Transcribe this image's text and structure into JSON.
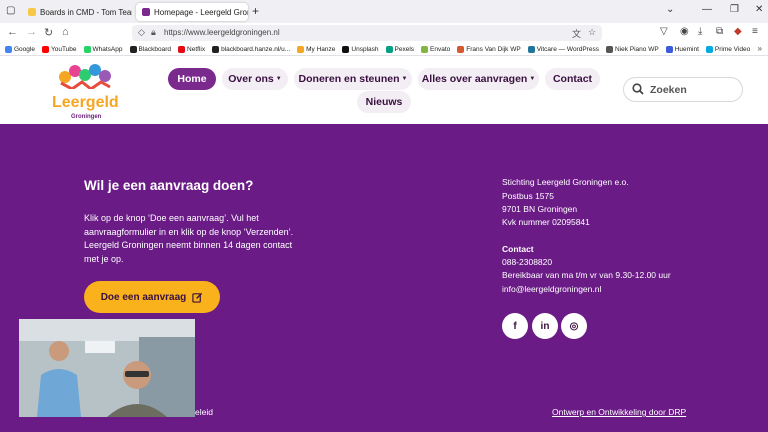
{
  "browser": {
    "tabs": [
      {
        "label": "Boards in CMD - Tom Team - …",
        "active": false,
        "favicon_color": "#f7c948"
      },
      {
        "label": "Homepage - Leergeld Groningen",
        "active": true,
        "favicon_color": "#7a2a8c"
      }
    ],
    "new_tab_label": "+",
    "url": "https://www.leergeldgroningen.nl",
    "bookmarks": [
      {
        "label": "Google",
        "color": "#4285f4"
      },
      {
        "label": "YouTube",
        "color": "#ff0000"
      },
      {
        "label": "WhatsApp",
        "color": "#25d366"
      },
      {
        "label": "Blackboard",
        "color": "#222222"
      },
      {
        "label": "Netflix",
        "color": "#e50914"
      },
      {
        "label": "blackboard.hanze.nl/u...",
        "color": "#222222"
      },
      {
        "label": "My Hanze",
        "color": "#f5a623"
      },
      {
        "label": "Unsplash",
        "color": "#111111"
      },
      {
        "label": "Pexels",
        "color": "#05a081"
      },
      {
        "label": "Envato",
        "color": "#82b541"
      },
      {
        "label": "Frans Van Dijk WP",
        "color": "#d65a31"
      },
      {
        "label": "Vitcare — WordPress",
        "color": "#21759b"
      },
      {
        "label": "Niek Piano WP",
        "color": "#555555"
      },
      {
        "label": "Huemint",
        "color": "#3b5bdb"
      },
      {
        "label": "Prime Video",
        "color": "#00a8e1"
      }
    ]
  },
  "site": {
    "logo": {
      "title": "Leergeld",
      "subtitle": "Groningen"
    },
    "nav": [
      {
        "label": "Home",
        "active": true,
        "dropdown": false
      },
      {
        "label": "Over ons",
        "active": false,
        "dropdown": true
      },
      {
        "label": "Doneren en steunen",
        "active": false,
        "dropdown": true
      },
      {
        "label": "Alles over aanvragen",
        "active": false,
        "dropdown": true
      },
      {
        "label": "Contact",
        "active": false,
        "dropdown": false
      },
      {
        "label": "Nieuws",
        "active": false,
        "dropdown": false
      }
    ],
    "search_placeholder": "Zoeken"
  },
  "footer": {
    "heading": "Wil je een aanvraag doen?",
    "paragraph": "Klik op de knop ‘Doe een aanvraag’. Vul het aanvraagformulier in en klik op de knop ‘Verzenden’. Leergeld Groningen neemt binnen 14 dagen contact met je op.",
    "cta_label": "Doe een aanvraag",
    "address": [
      "Stichting Leergeld Groningen e.o.",
      "Postbus 1575",
      "9701 BN Groningen",
      "Kvk nummer 02095841"
    ],
    "contact_heading": "Contact",
    "contact": [
      "088-2308820",
      "Bereikbaar van ma t/m vr van 9.30-12.00 uur",
      "info@leergeldgroningen.nl"
    ],
    "social": [
      {
        "icon": "facebook-icon",
        "glyph": "f"
      },
      {
        "icon": "linkedin-icon",
        "glyph": "in"
      },
      {
        "icon": "instagram-icon",
        "glyph": "◎"
      }
    ],
    "bottom_left": "eleid",
    "bottom_right": "Ontwerp en Ontwikkeling door DRP"
  },
  "colors": {
    "brand_purple": "#6a1b86",
    "accent_orange": "#f9b21b",
    "home_pill": "#7a2a8c"
  }
}
